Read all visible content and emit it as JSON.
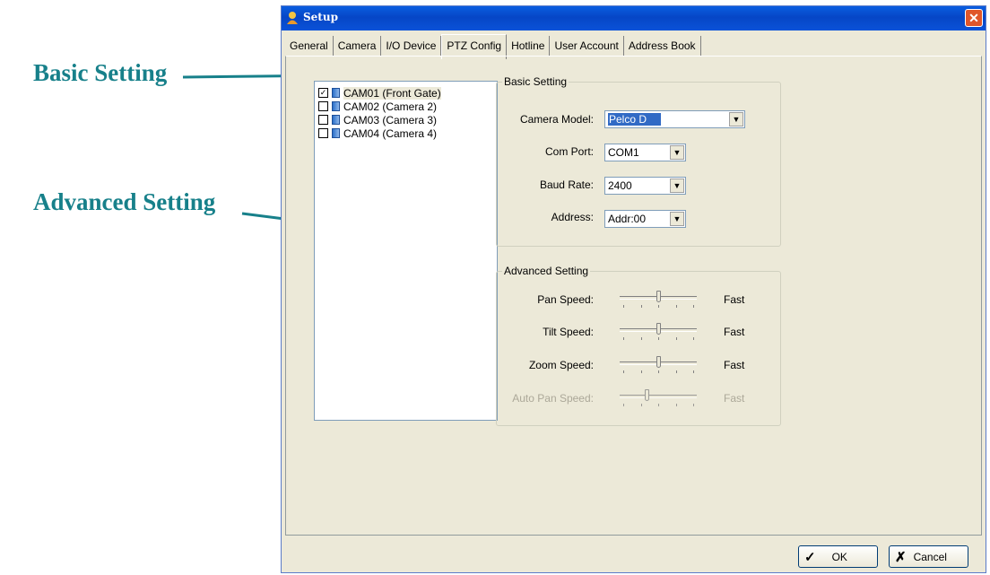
{
  "annotations": {
    "basic": "Basic Setting",
    "advanced": "Advanced Setting"
  },
  "window": {
    "title": "Setup",
    "close_glyph": "✕"
  },
  "tabs": [
    "General",
    "Camera",
    "I/O Device",
    "PTZ Config",
    "Hotline",
    "User Account",
    "Address Book"
  ],
  "active_tab": "PTZ Config",
  "cameras": [
    {
      "label": "CAM01 (Front Gate)",
      "checked": true,
      "selected": true
    },
    {
      "label": "CAM02 (Camera 2)",
      "checked": false,
      "selected": false
    },
    {
      "label": "CAM03 (Camera 3)",
      "checked": false,
      "selected": false
    },
    {
      "label": "CAM04 (Camera 4)",
      "checked": false,
      "selected": false
    }
  ],
  "basic": {
    "legend": "Basic Setting",
    "camera_model_label": "Camera Model:",
    "camera_model_value": "Pelco D",
    "com_port_label": "Com Port:",
    "com_port_value": "COM1",
    "baud_rate_label": "Baud Rate:",
    "baud_rate_value": "2400",
    "address_label": "Address:",
    "address_value": "Addr:00"
  },
  "advanced": {
    "legend": "Advanced Setting",
    "pan_label": "Pan Speed:",
    "tilt_label": "Tilt Speed:",
    "zoom_label": "Zoom Speed:",
    "autopan_label": "Auto Pan Speed:",
    "fast_label": "Fast",
    "pan_level": 0.5,
    "tilt_level": 0.5,
    "zoom_level": 0.5,
    "autopan_level": 0.33,
    "autopan_enabled": false
  },
  "buttons": {
    "ok": "OK",
    "cancel": "Cancel",
    "ok_icon": "checkmark-icon",
    "cancel_icon": "x-icon"
  },
  "colors": {
    "annotation": "#17808a",
    "title_bar": "#0a5ee0",
    "dialog_bg": "#ece9d8",
    "selection": "#316ac5"
  }
}
